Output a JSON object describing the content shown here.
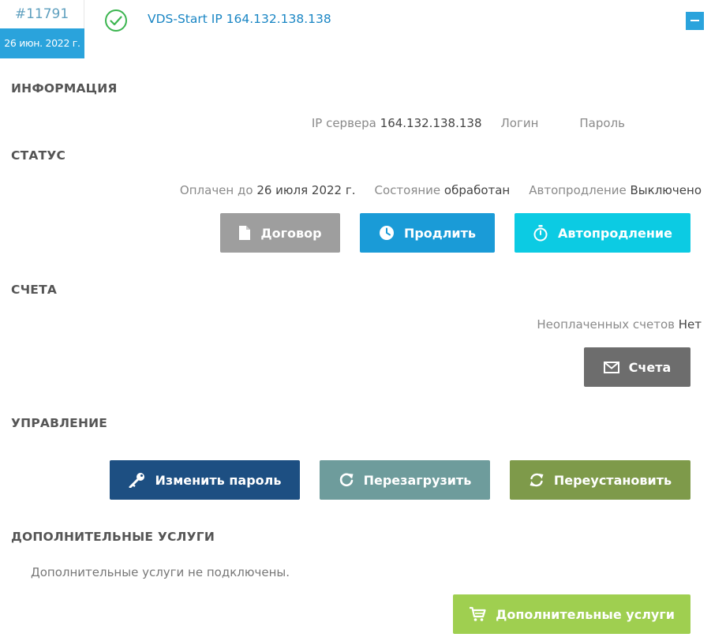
{
  "service": {
    "id": "#11791",
    "date": "26 июн. 2022 г.",
    "title": "VDS-Start IP 164.132.138.138",
    "status_icon": "check-circle-icon",
    "collapse_icon": "minus-icon"
  },
  "sections": {
    "info": "ИНФОРМАЦИЯ",
    "status": "СТАТУС",
    "invoices": "СЧЕТА",
    "management": "УПРАВЛЕНИЕ",
    "addons": "ДОПОЛНИТЕЛЬНЫЕ УСЛУГИ"
  },
  "info": {
    "ip_label": "IP сервера",
    "ip_value": "164.132.138.138",
    "login_label": "Логин",
    "password_label": "Пароль"
  },
  "status": {
    "paid_until_label": "Оплачен до",
    "paid_until_value": "26 июля 2022 г.",
    "state_label": "Состояние",
    "state_value": "обработан",
    "autorenew_label": "Автопродление",
    "autorenew_value": "Выключено"
  },
  "invoices": {
    "unpaid_label": "Неоплаченных счетов",
    "unpaid_value": "Нет"
  },
  "buttons": {
    "contract": {
      "label": "Договор",
      "icon": "document-icon",
      "color": "#9e9e9e"
    },
    "renew": {
      "label": "Продлить",
      "icon": "clock-icon",
      "color": "#1a9bd7"
    },
    "autorenew": {
      "label": "Автопродление",
      "icon": "stopwatch-icon",
      "color": "#0ccbe3"
    },
    "invoices": {
      "label": "Счета",
      "icon": "envelope-icon",
      "color": "#6d6d6d"
    },
    "change_password": {
      "label": "Изменить пароль",
      "icon": "key-icon",
      "color": "#1d4f82"
    },
    "reboot": {
      "label": "Перезагрузить",
      "icon": "refresh-icon",
      "color": "#6e9c9c"
    },
    "reinstall": {
      "label": "Переустановить",
      "icon": "sync-icon",
      "color": "#7e9a4a"
    },
    "addons": {
      "label": "Дополнительные услуги",
      "icon": "cart-icon",
      "color": "#9fcf50"
    }
  },
  "addons": {
    "empty_text": "Дополнительные услуги не подключены."
  }
}
